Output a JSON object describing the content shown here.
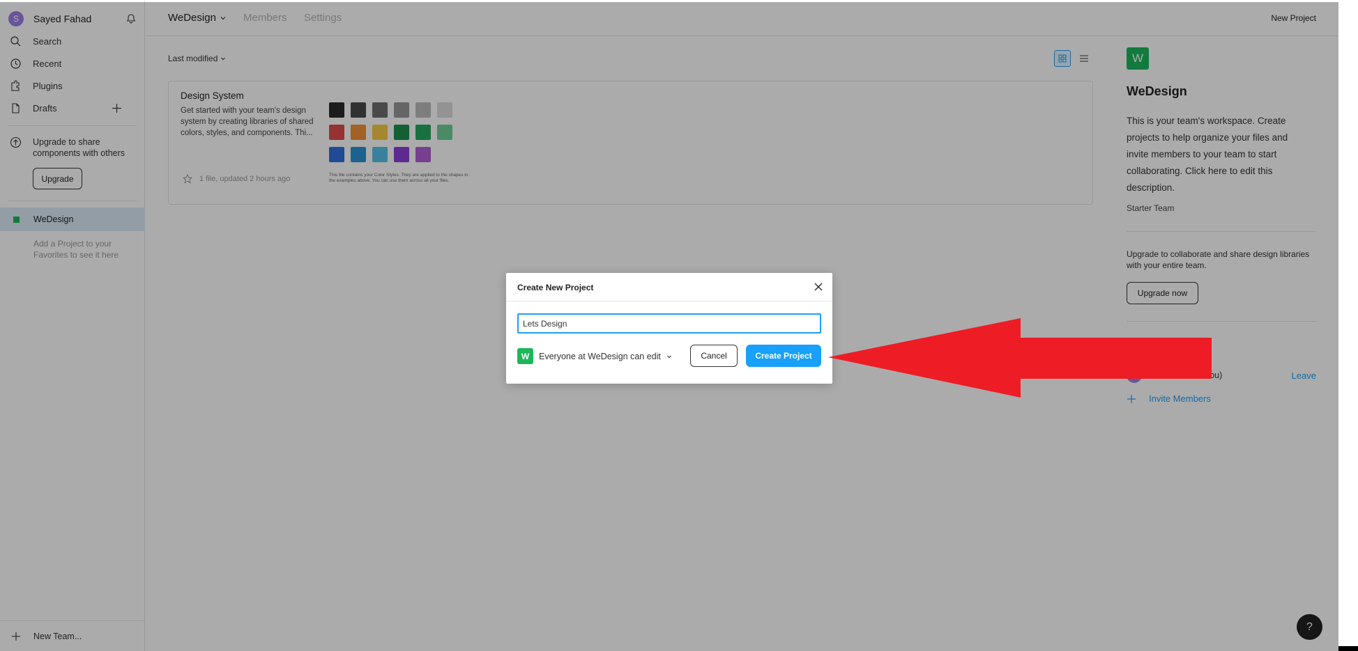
{
  "sidebar": {
    "user_initial": "S",
    "user_name": "Sayed Fahad",
    "nav": {
      "search": "Search",
      "recent": "Recent",
      "plugins": "Plugins",
      "drafts": "Drafts"
    },
    "upgrade_note": "Upgrade to share components with others",
    "upgrade_button": "Upgrade",
    "team_name": "WeDesign",
    "favorites_hint": "Add a Project to your Favorites to see it here",
    "new_team": "New Team..."
  },
  "header": {
    "team_title": "WeDesign",
    "tabs": [
      "Members",
      "Settings"
    ],
    "new_project": "New Project"
  },
  "main": {
    "sort_label": "Last modified",
    "card": {
      "title": "Design System",
      "description": "Get started with your team's design system by creating libraries of shared colors, styles, and components. Thi...",
      "meta": "1 file, updated 2 hours ago",
      "swatch_note": "This file contains your Color Styles. They are applied to the shapes in the examples above. You can use them across all your files.",
      "swatch_colors": [
        [
          "#2b2b2b",
          "#4a4a4a",
          "#6f6f6f",
          "#979797",
          "#bdbdbd",
          "#dcdcdc"
        ],
        [
          "#e04b4b",
          "#f0913b",
          "#f7c944",
          "#1e8f4e",
          "#25a960",
          "#6fcf97"
        ],
        [
          "#2d6fe0",
          "#2a93d5",
          "#56c1e6",
          "#8b3fd9",
          "#b05fd6"
        ]
      ]
    }
  },
  "right_panel": {
    "logo_letter": "W",
    "team_name": "WeDesign",
    "description": "This is your team's workspace. Create projects to help organize your files and invite members to your team to start collaborating. Click here to edit this description.",
    "plan": "Starter Team",
    "upgrade_text": "Upgrade to collaborate and share design libraries with your entire team.",
    "upgrade_button": "Upgrade now",
    "member_suffix": "You)",
    "leave": "Leave",
    "invite": "Invite Members"
  },
  "help": "?",
  "modal": {
    "title": "Create New Project",
    "input_value": "Lets Design",
    "perm_letter": "W",
    "permission": "Everyone at WeDesign can edit",
    "cancel": "Cancel",
    "create": "Create Project"
  },
  "colors": {
    "accent": "#18a0fb",
    "team_green": "#1bb75a",
    "annotation_red": "#ee1c25"
  }
}
